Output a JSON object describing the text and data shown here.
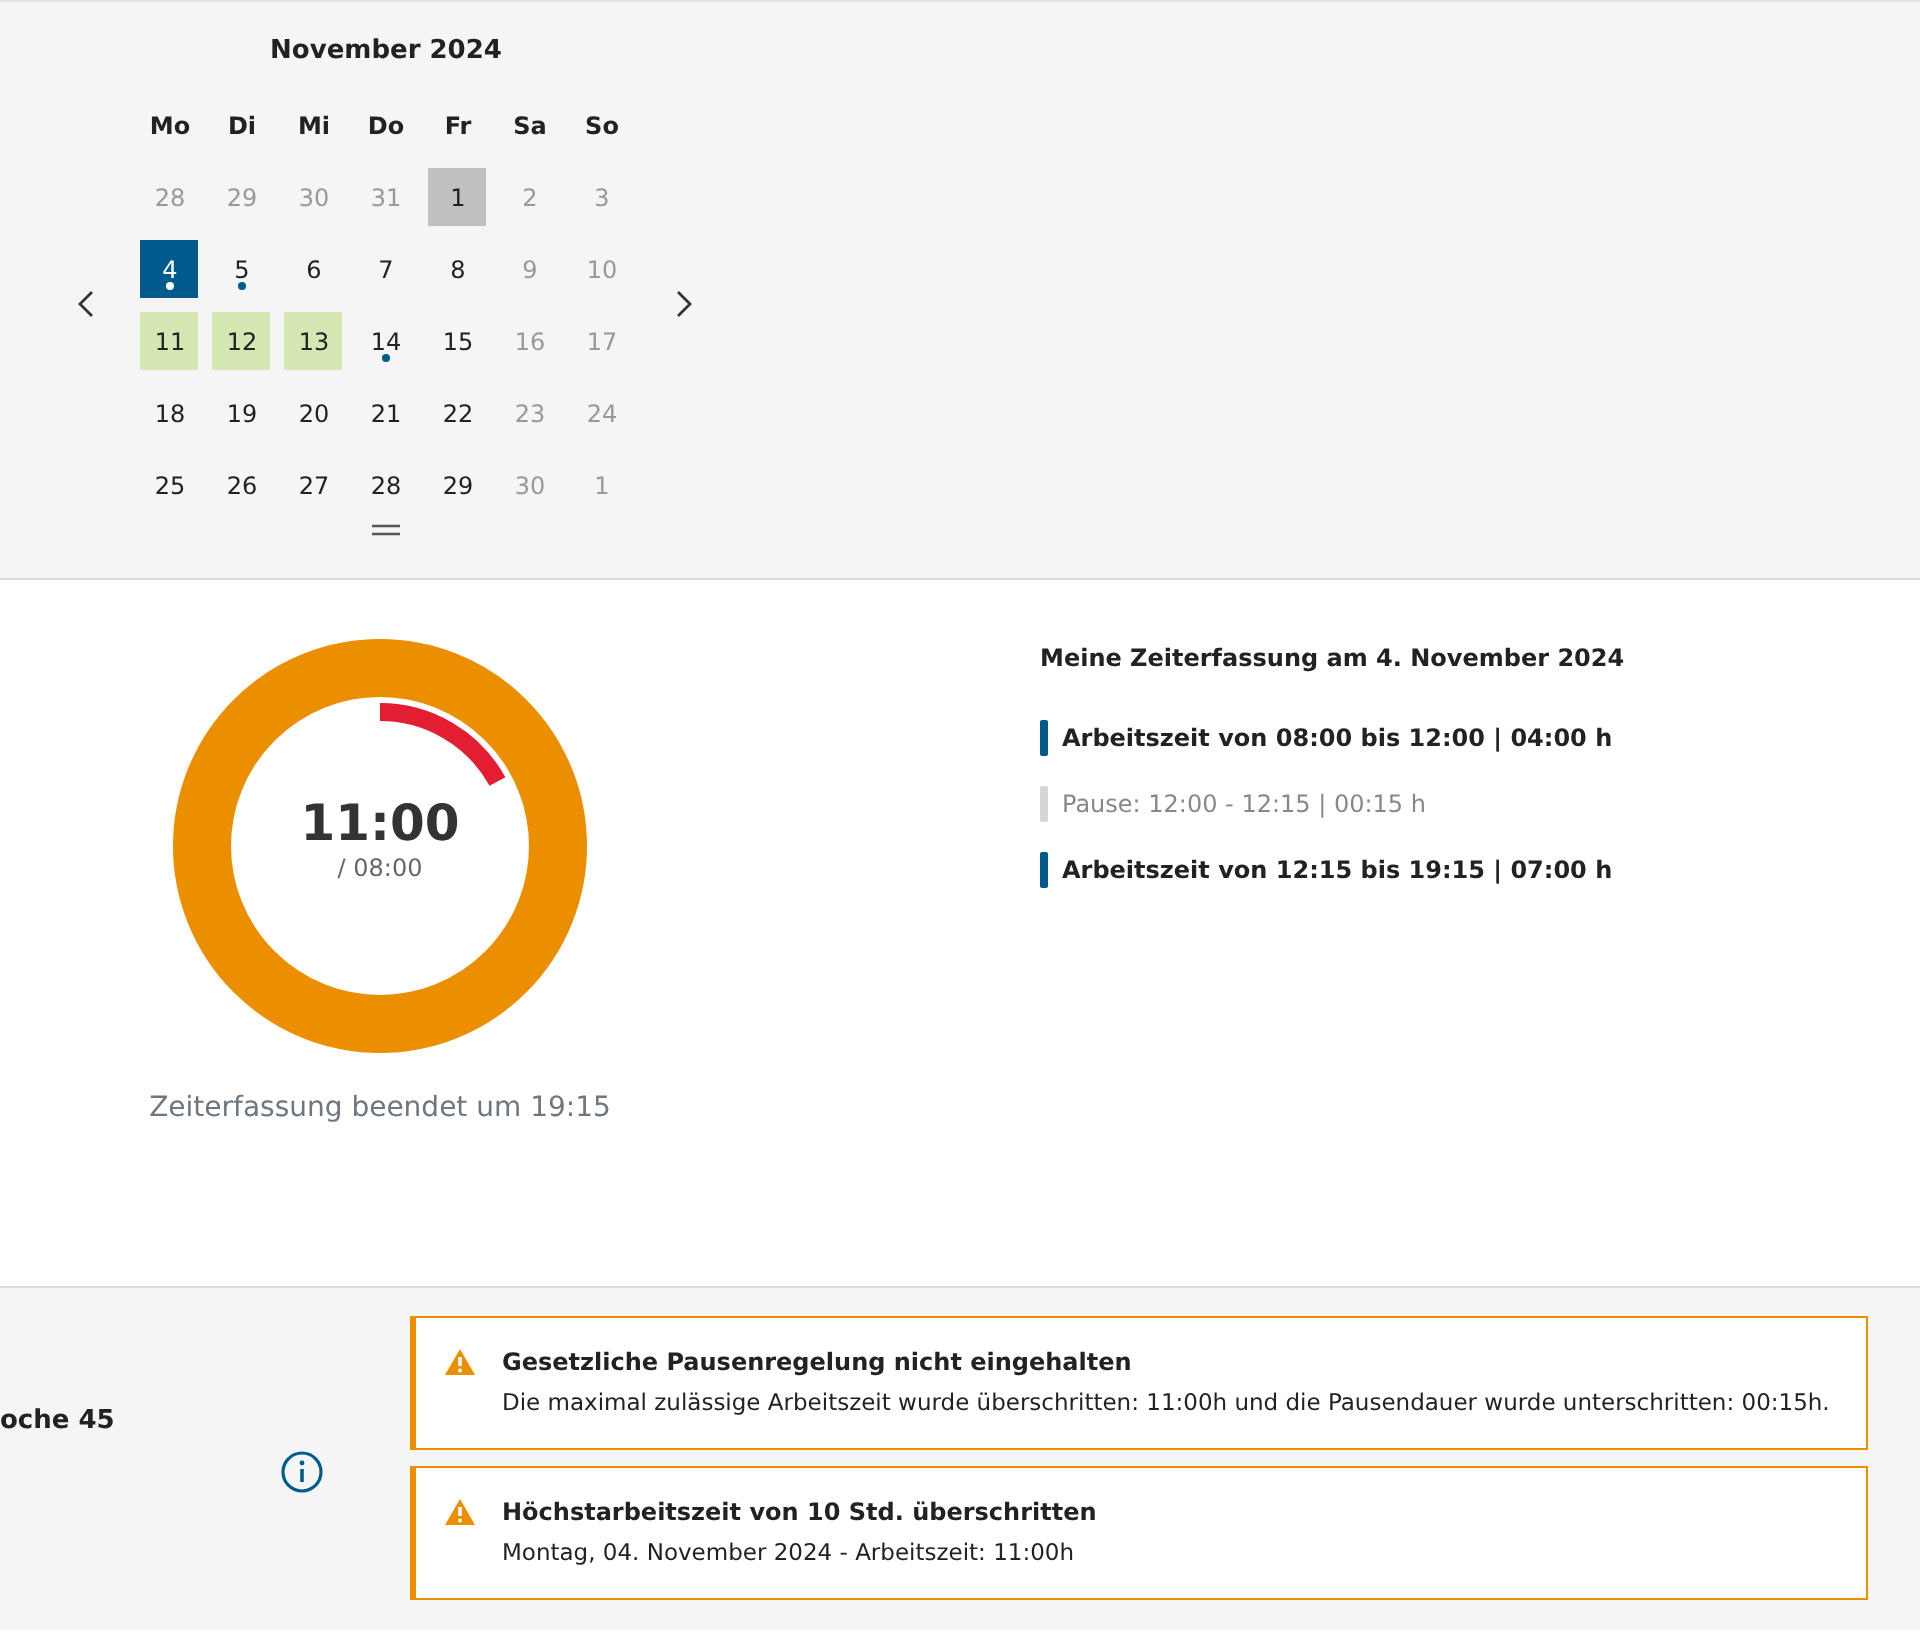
{
  "calendar": {
    "month": "November 2024",
    "weekdays": [
      "Mo",
      "Di",
      "Mi",
      "Do",
      "Fr",
      "Sa",
      "So"
    ],
    "weeks": [
      [
        {
          "day": "28",
          "muted": true,
          "kind": "default",
          "marker": false
        },
        {
          "day": "29",
          "muted": true,
          "kind": "default",
          "marker": false
        },
        {
          "day": "30",
          "muted": true,
          "kind": "default",
          "marker": false
        },
        {
          "day": "31",
          "muted": true,
          "kind": "default",
          "marker": false
        },
        {
          "day": "1",
          "muted": false,
          "kind": "holiday",
          "marker": false
        },
        {
          "day": "2",
          "muted": true,
          "kind": "default",
          "marker": false
        },
        {
          "day": "3",
          "muted": true,
          "kind": "default",
          "marker": false
        }
      ],
      [
        {
          "day": "4",
          "muted": false,
          "kind": "selected",
          "marker": true
        },
        {
          "day": "5",
          "muted": false,
          "kind": "default",
          "marker": true
        },
        {
          "day": "6",
          "muted": false,
          "kind": "default",
          "marker": false
        },
        {
          "day": "7",
          "muted": false,
          "kind": "default",
          "marker": false
        },
        {
          "day": "8",
          "muted": false,
          "kind": "default",
          "marker": false
        },
        {
          "day": "9",
          "muted": true,
          "kind": "default",
          "marker": false
        },
        {
          "day": "10",
          "muted": true,
          "kind": "default",
          "marker": false
        }
      ],
      [
        {
          "day": "11",
          "muted": false,
          "kind": "vacation",
          "marker": false
        },
        {
          "day": "12",
          "muted": false,
          "kind": "vacation",
          "marker": false
        },
        {
          "day": "13",
          "muted": false,
          "kind": "vacation",
          "marker": false
        },
        {
          "day": "14",
          "muted": false,
          "kind": "default",
          "marker": true
        },
        {
          "day": "15",
          "muted": false,
          "kind": "default",
          "marker": false
        },
        {
          "day": "16",
          "muted": true,
          "kind": "default",
          "marker": false
        },
        {
          "day": "17",
          "muted": true,
          "kind": "default",
          "marker": false
        }
      ],
      [
        {
          "day": "18",
          "muted": false,
          "kind": "default",
          "marker": false
        },
        {
          "day": "19",
          "muted": false,
          "kind": "default",
          "marker": false
        },
        {
          "day": "20",
          "muted": false,
          "kind": "default",
          "marker": false
        },
        {
          "day": "21",
          "muted": false,
          "kind": "default",
          "marker": false
        },
        {
          "day": "22",
          "muted": false,
          "kind": "default",
          "marker": false
        },
        {
          "day": "23",
          "muted": true,
          "kind": "default",
          "marker": false
        },
        {
          "day": "24",
          "muted": true,
          "kind": "default",
          "marker": false
        }
      ],
      [
        {
          "day": "25",
          "muted": false,
          "kind": "default",
          "marker": false
        },
        {
          "day": "26",
          "muted": false,
          "kind": "default",
          "marker": false
        },
        {
          "day": "27",
          "muted": false,
          "kind": "default",
          "marker": false
        },
        {
          "day": "28",
          "muted": false,
          "kind": "default",
          "marker": false
        },
        {
          "day": "29",
          "muted": false,
          "kind": "default",
          "marker": false
        },
        {
          "day": "30",
          "muted": true,
          "kind": "default",
          "marker": false
        },
        {
          "day": "1",
          "muted": true,
          "kind": "default",
          "marker": false
        }
      ]
    ]
  },
  "summary": {
    "ring": {
      "level": 1
    },
    "overtime": {
      "level": 0.17
    },
    "worked": "11:00",
    "target": "/ 08:00",
    "status": "Zeiterfassung beendet um 19:15"
  },
  "entries": {
    "title": "Meine Zeiterfassung am 4. November 2024",
    "items": [
      {
        "kind": "work",
        "text": "Arbeitszeit von 08:00 bis 12:00 | 04:00 h"
      },
      {
        "kind": "pause",
        "text": "Pause: 12:00 - 12:15 | 00:15 h"
      },
      {
        "kind": "work",
        "text": "Arbeitszeit von 12:15 bis 19:15 | 07:00 h"
      }
    ]
  },
  "week": {
    "label": "oche 45",
    "alerts": [
      {
        "title": "Gesetzliche Pausenregelung nicht eingehalten",
        "text": "Die maximal zulässige Arbeitszeit wurde überschritten: 11:00h und die Pausendauer wurde unterschritten: 00:15h."
      },
      {
        "title": "Höchstarbeitszeit von 10 Std. überschritten",
        "text": "Montag, 04. November 2024 - Arbeitszeit: 11:00h"
      }
    ]
  }
}
